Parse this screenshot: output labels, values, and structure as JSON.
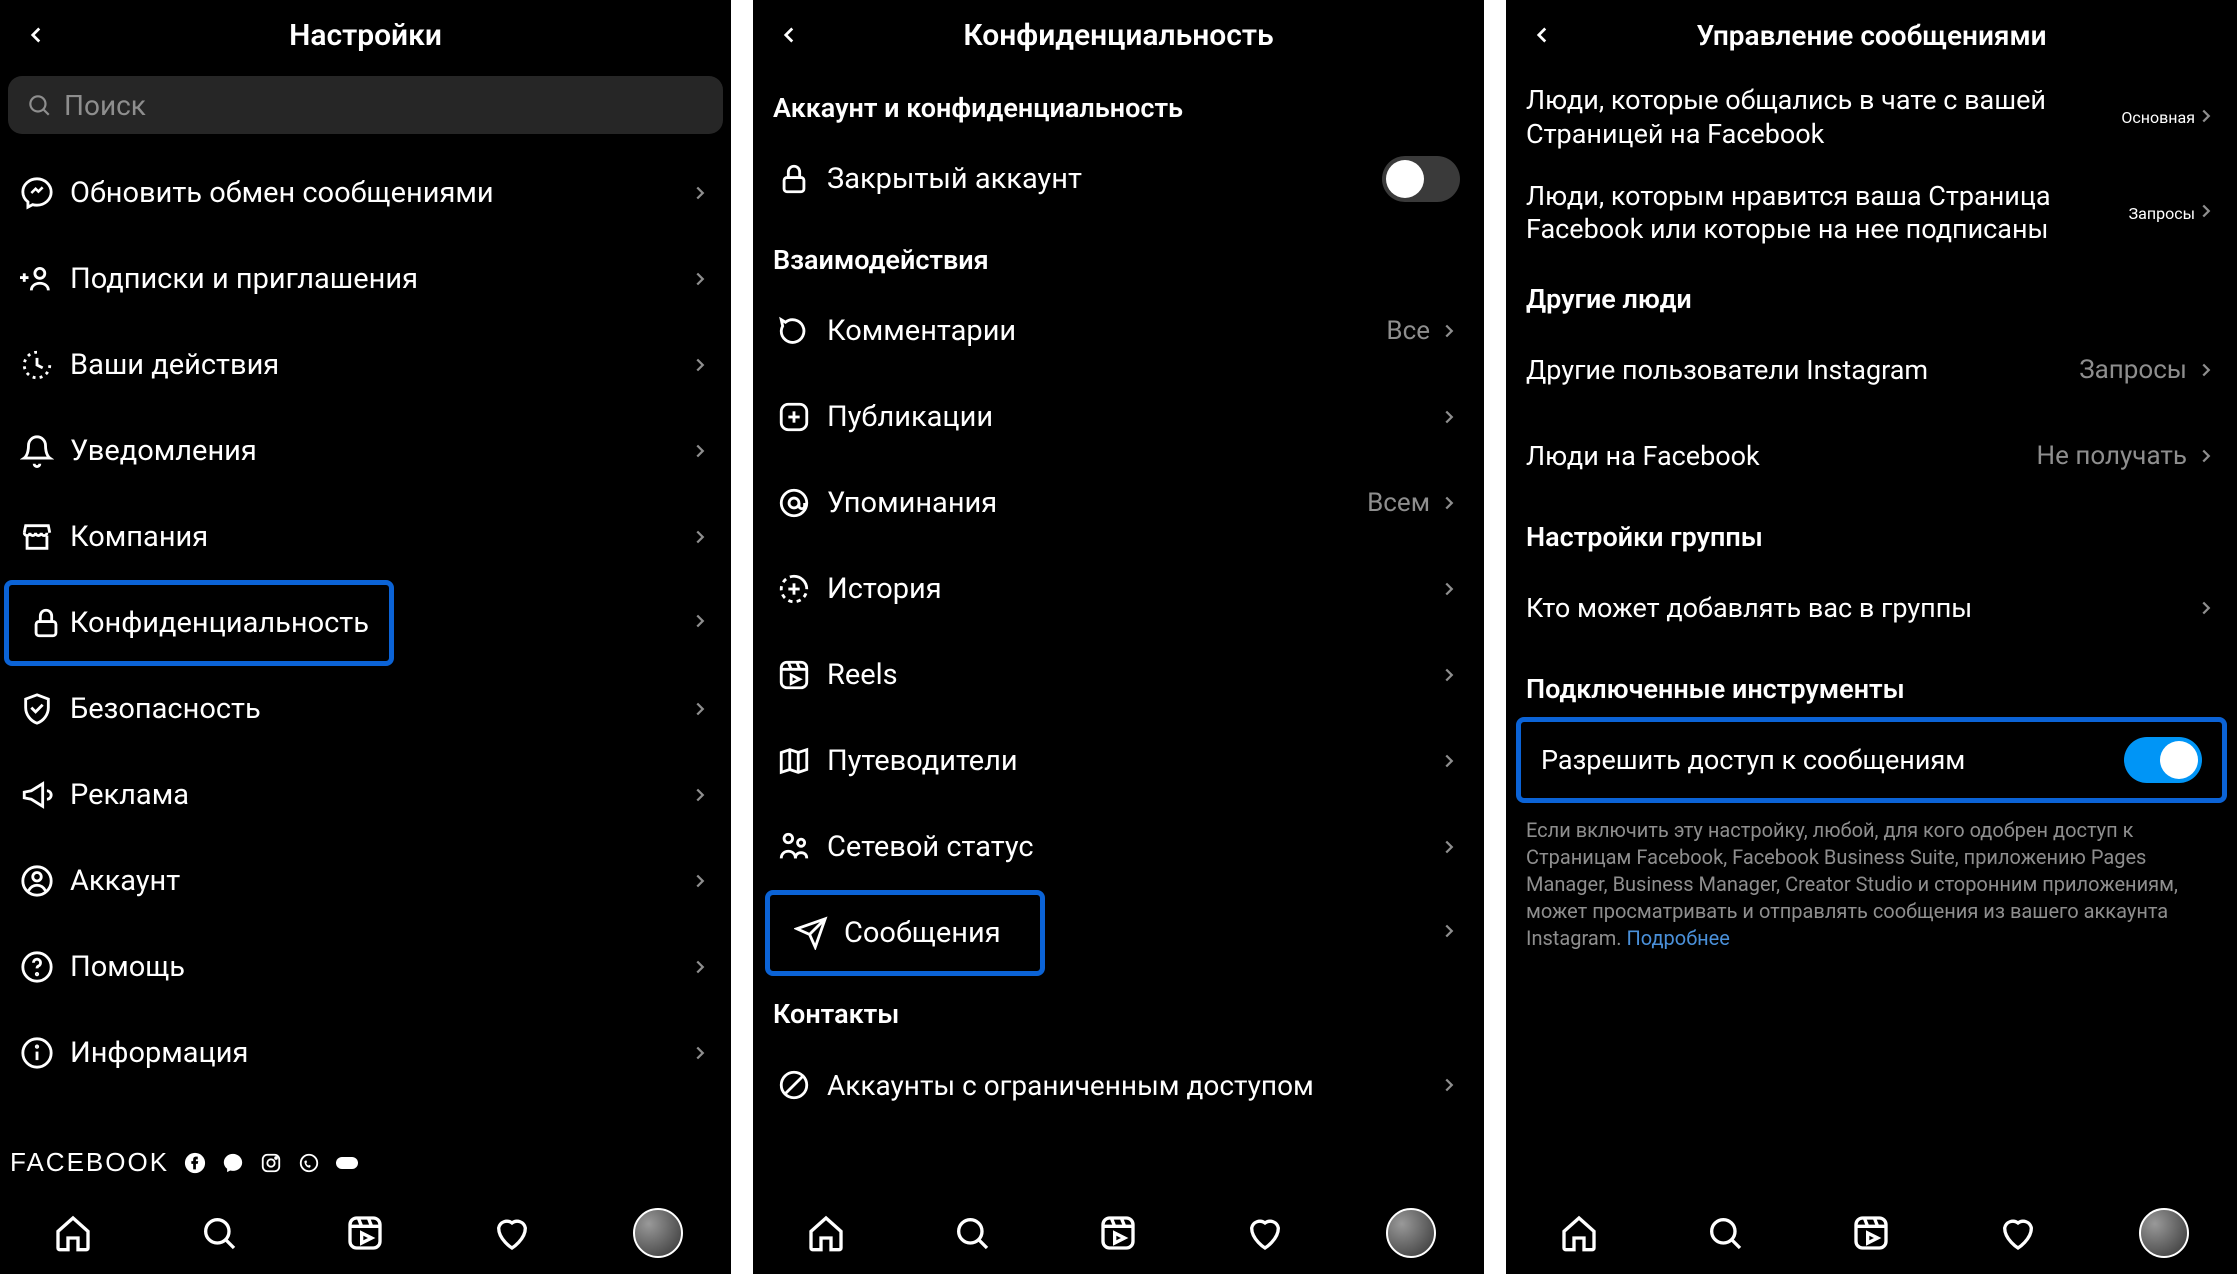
{
  "screens": {
    "settings": {
      "title": "Настройки",
      "search_placeholder": "Поиск",
      "items": [
        {
          "label": "Обновить обмен сообщениями",
          "icon": "messenger"
        },
        {
          "label": "Подписки и приглашения",
          "icon": "add-person"
        },
        {
          "label": "Ваши действия",
          "icon": "activity"
        },
        {
          "label": "Уведомления",
          "icon": "bell"
        },
        {
          "label": "Компания",
          "icon": "store"
        },
        {
          "label": "Конфиденциальность",
          "icon": "lock",
          "highlight": true
        },
        {
          "label": "Безопасность",
          "icon": "shield"
        },
        {
          "label": "Реклама",
          "icon": "megaphone"
        },
        {
          "label": "Аккаунт",
          "icon": "account-circle"
        },
        {
          "label": "Помощь",
          "icon": "help"
        },
        {
          "label": "Информация",
          "icon": "info"
        }
      ],
      "footer_brand": "FACEBOOK"
    },
    "privacy": {
      "title": "Конфиденциальность",
      "section1": "Аккаунт и конфиденциальность",
      "private_account": "Закрытый аккаунт",
      "section2": "Взаимодействия",
      "items": [
        {
          "label": "Комментарии",
          "icon": "comment",
          "value": "Все"
        },
        {
          "label": "Публикации",
          "icon": "plus-square"
        },
        {
          "label": "Упоминания",
          "icon": "at",
          "value": "Всем"
        },
        {
          "label": "История",
          "icon": "story"
        },
        {
          "label": "Reels",
          "icon": "reels"
        },
        {
          "label": "Путеводители",
          "icon": "map"
        },
        {
          "label": "Сетевой статус",
          "icon": "network"
        },
        {
          "label": "Сообщения",
          "icon": "send",
          "highlight": true
        }
      ],
      "section3": "Контакты",
      "restricted": "Аккаунты с ограниченным доступом"
    },
    "messages": {
      "title": "Управление сообщениями",
      "rows1": [
        {
          "label": "Люди, которые общались в чате с вашей Страницей на Facebook",
          "value": "Основная"
        },
        {
          "label": "Люди, которым нравится ваша Страница Facebook или которые на нее подписаны",
          "value": "Запросы"
        }
      ],
      "section_other": "Другие люди",
      "rows2": [
        {
          "label": "Другие пользователи Instagram",
          "value": "Запросы"
        },
        {
          "label": "Люди на Facebook",
          "value": "Не получать"
        }
      ],
      "section_group": "Настройки группы",
      "group_row": "Кто может добавлять вас в группы",
      "section_tools": "Подключенные инструменты",
      "allow_access": "Разрешить доступ к сообщениям",
      "desc": "Если включить эту настройку, любой, для кого одобрен доступ к Страницам Facebook, Facebook Business Suite, приложению Pages Manager, Business Manager, Creator Studio и сторонним приложениям, может просматривать и отправлять сообщения из вашего аккаунта Instagram.",
      "more": "Подробнее"
    }
  }
}
